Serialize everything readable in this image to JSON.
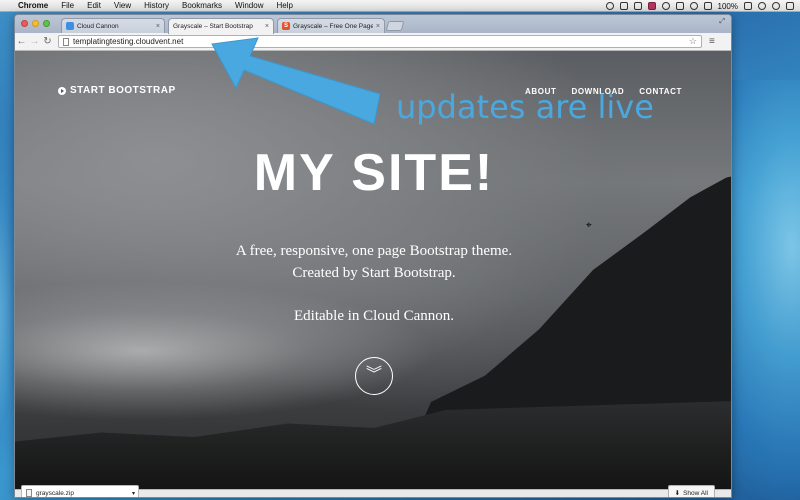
{
  "menubar": {
    "app": "Chrome",
    "items": [
      "File",
      "Edit",
      "View",
      "History",
      "Bookmarks",
      "Window",
      "Help"
    ],
    "battery": "100%",
    "icons": [
      "record-icon",
      "dropbox-icon",
      "sync-icon",
      "flag-icon",
      "refresh-icon",
      "bluetooth-icon",
      "wifi-icon",
      "volume-icon",
      "battery-icon",
      "clock-icon",
      "search-icon",
      "list-icon"
    ]
  },
  "browser": {
    "tabs": [
      {
        "label": "Cloud Cannon",
        "favicon": "cloudcannon-icon"
      },
      {
        "label": "Grayscale – Start Bootstrap",
        "favicon": "page-icon",
        "active": true
      },
      {
        "label": "Grayscale – Free One Page",
        "favicon": "s-icon"
      }
    ],
    "url": "templatingtesting.cloudvent.net"
  },
  "site": {
    "brand": "START BOOTSTRAP",
    "nav": [
      "ABOUT",
      "DOWNLOAD",
      "CONTACT"
    ],
    "title": "MY SITE!",
    "line1": "A free, responsive, one page Bootstrap theme.",
    "line2": "Created by Start Bootstrap.",
    "line3": "Editable in Cloud Cannon."
  },
  "annotation": {
    "text": "updates are live",
    "color": "#4aa8e0"
  },
  "downloads": {
    "file": "grayscale.zip",
    "show_all": "Show All"
  }
}
